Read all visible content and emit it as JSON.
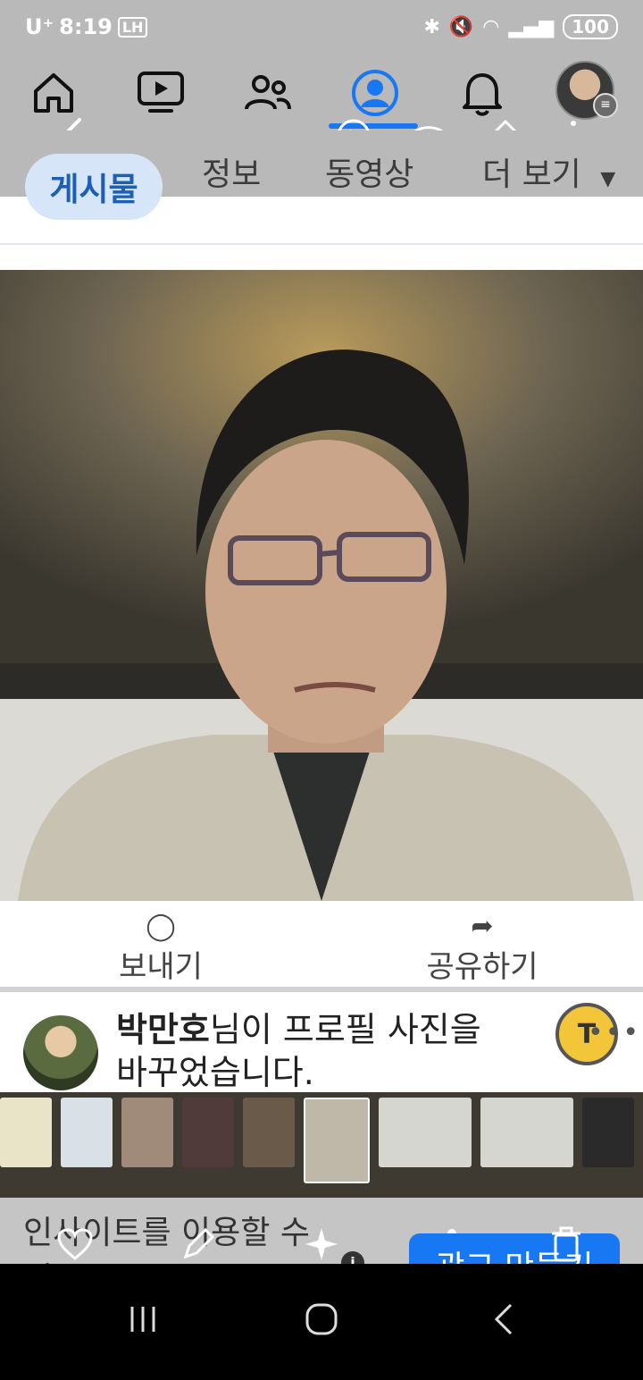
{
  "status": {
    "carrier": "U⁺",
    "time": "8:19",
    "badge": "LH",
    "battery": "100"
  },
  "nav": {
    "items": [
      "home",
      "watch",
      "friends",
      "profile",
      "notifications",
      "menu"
    ]
  },
  "tabs": [
    {
      "label": "게시물"
    },
    {
      "label": "정보"
    },
    {
      "label": "동영상"
    },
    {
      "label": "더 보기"
    }
  ],
  "actions": {
    "send": "보내기",
    "share": "공유하기"
  },
  "post": {
    "author": "박만호",
    "text_line1": "님이 프로필 사진을",
    "text_line2": "바꾸었습니다.",
    "more": "•••",
    "badge": "T"
  },
  "insight": {
    "text": "인사이트를 이용할 수",
    "text2": "없음",
    "info": "i",
    "ad_button": "광고 만들기"
  },
  "colors": {
    "accent": "#1877f2",
    "statusbar": "#b9b9b9"
  }
}
